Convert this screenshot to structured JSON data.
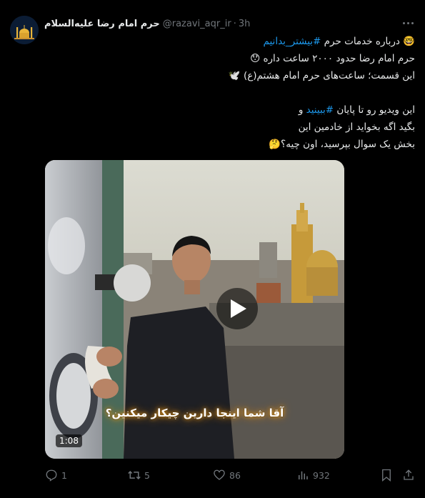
{
  "author": {
    "display_name": "حرم امام رضا علیه‌السلام",
    "handle": "@razavi_aqr_ir",
    "separator": "·",
    "time": "3h"
  },
  "tweet": {
    "line1_text": "درباره خدمات حرم ",
    "line1_hashtag": "#بیشتر_بدانیم",
    "line1_emoji": "🤓",
    "line2_text": "حرم امام رضا حدود ۲۰۰۰ ساعت داره ",
    "line2_emoji": "😯",
    "line3_text": "این قسمت؛ ساعت‌های حرم امام هشتم(ع) ",
    "line3_emoji": "🕊️",
    "line5_text_a": "این ویدیو رو تا پایان ",
    "line5_hashtag": "#ببینید",
    "line5_text_b": " و",
    "line6_text": "بگید اگه بخواید از خادمین این",
    "line7_text": "بخش یک سوال بپرسید، اون چیه؟",
    "line7_emoji": "🤔"
  },
  "media": {
    "caption": "آقا شما اینجا دارین چیکار میکنین؟",
    "duration": "1:08",
    "play_icon": "play-icon"
  },
  "actions": {
    "replies": "1",
    "reposts": "5",
    "likes": "86",
    "views": "932"
  },
  "colors": {
    "background": "#000000",
    "text": "#e7e9ea",
    "muted": "#71767b",
    "link": "#1d9bf0"
  }
}
